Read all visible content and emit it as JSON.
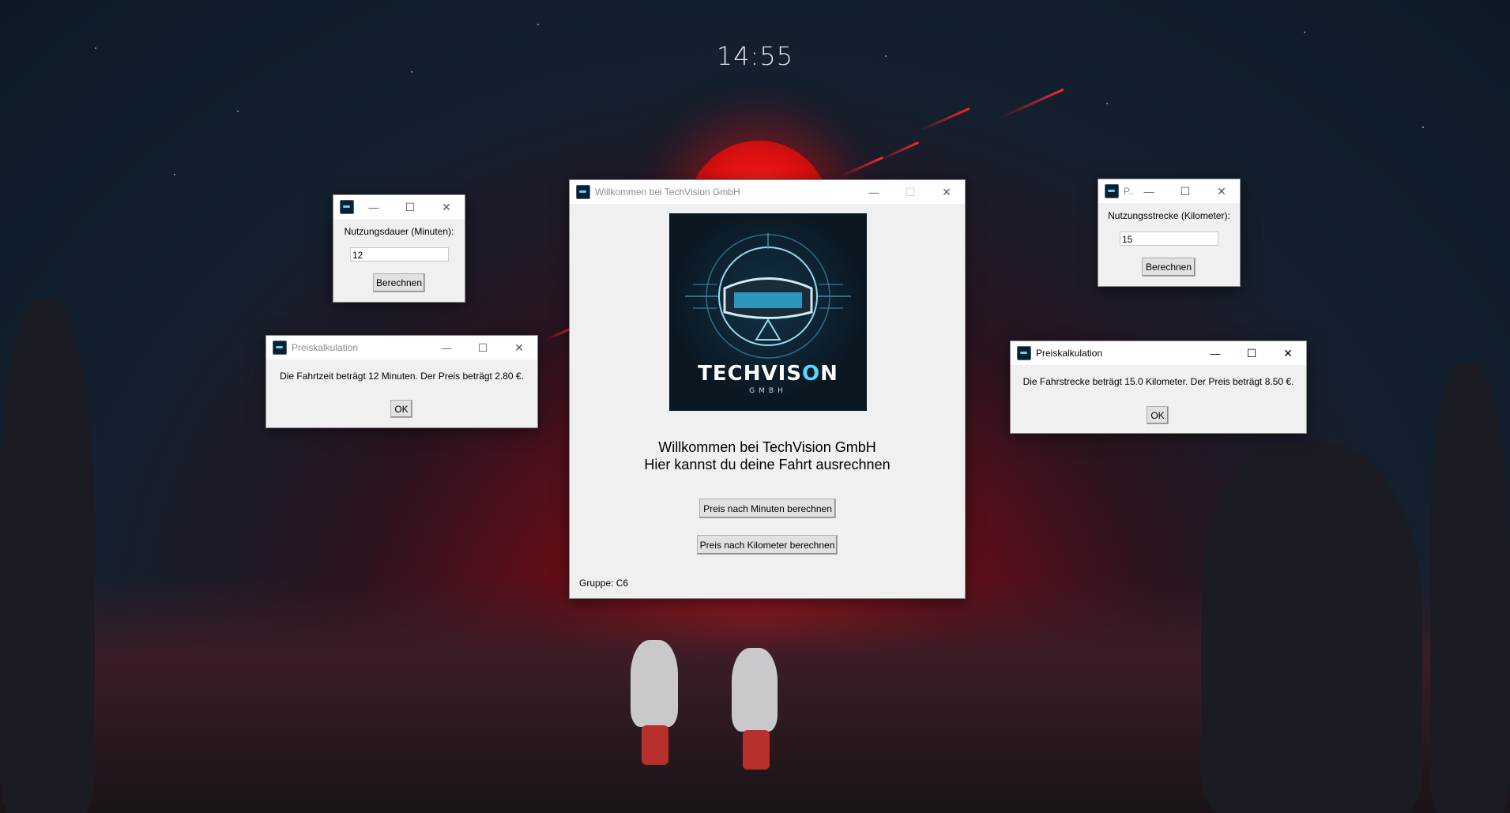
{
  "desktop": {
    "clock": "14:55",
    "accent": "#e01010"
  },
  "main_window": {
    "title": "Willkommen bei TechVision GmbH",
    "logo_text": "TECHVIS",
    "logo_text_o": "O",
    "logo_text_end": "N",
    "logo_sub": "GMBH",
    "welcome_line1": "Willkommen bei TechVision GmbH",
    "welcome_line2": "Hier kannst du deine Fahrt ausrechnen",
    "btn_minutes": "Preis nach Minuten berechnen",
    "btn_km": "Preis nach Kilometer berechnen",
    "group": "Gruppe: C6"
  },
  "minutes_input": {
    "label": "Nutzungsdauer (Minuten):",
    "value": "12",
    "button": "Berechnen"
  },
  "km_input": {
    "title": "P...",
    "label": "Nutzungsstrecke (Kilometer):",
    "value": "15",
    "button": "Berechnen"
  },
  "minutes_result": {
    "title": "Preiskalkulation",
    "message": "Die Fahrtzeit beträgt 12 Minuten. Der Preis beträgt 2.80 €.",
    "ok": "OK"
  },
  "km_result": {
    "title": "Preiskalkulation",
    "message": "Die Fahrstrecke beträgt 15.0 Kilometer. Der Preis beträgt 8.50 €.",
    "ok": "OK"
  },
  "controls": {
    "minimize": "—",
    "maximize": "☐",
    "close": "✕"
  }
}
